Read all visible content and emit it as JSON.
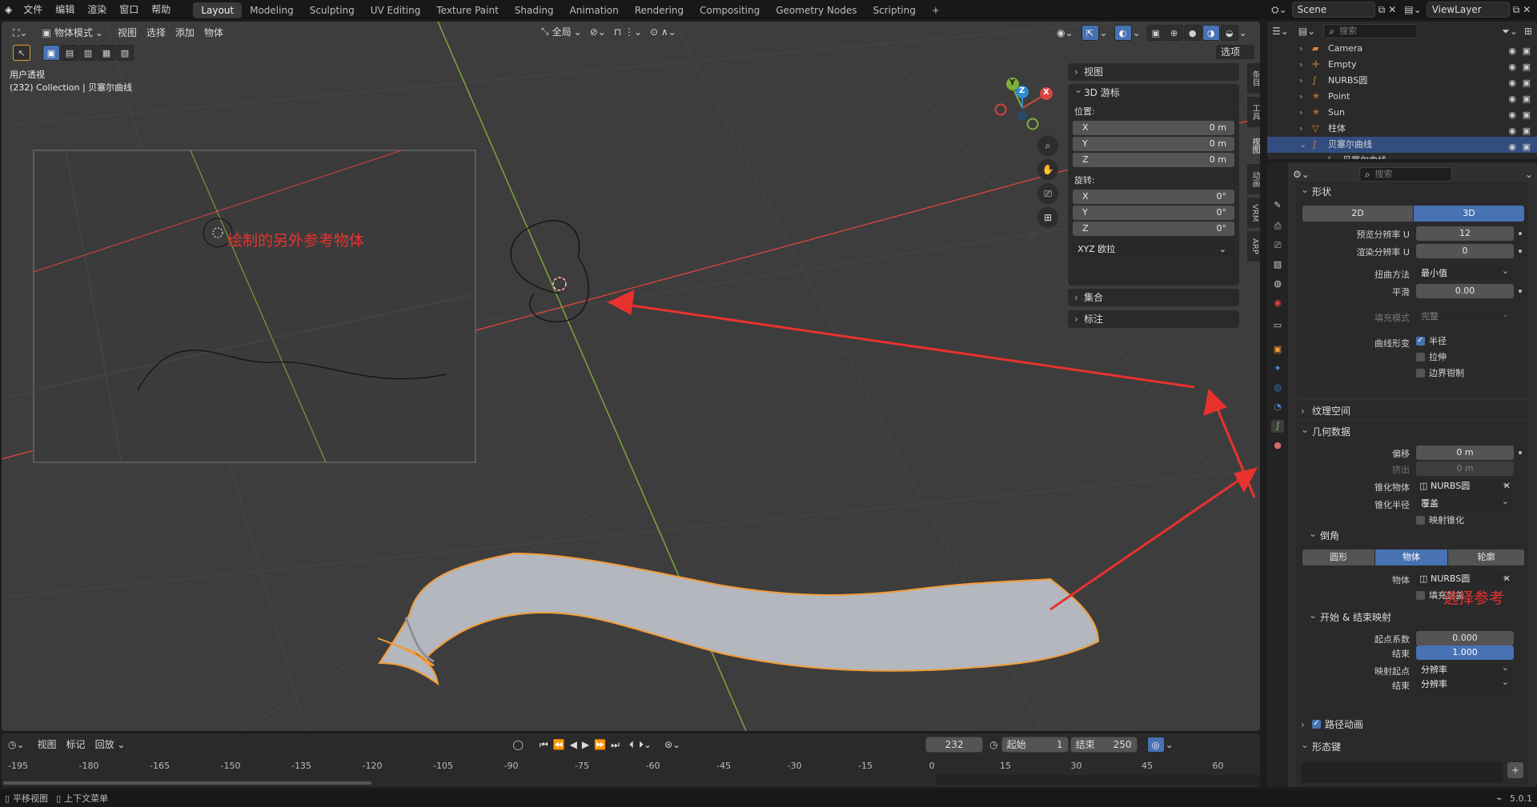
{
  "topbar": {
    "menus": [
      "文件",
      "编辑",
      "渲染",
      "窗口",
      "帮助"
    ],
    "workspaces": [
      "Layout",
      "Modeling",
      "Sculpting",
      "UV Editing",
      "Texture Paint",
      "Shading",
      "Animation",
      "Rendering",
      "Compositing",
      "Geometry Nodes",
      "Scripting"
    ],
    "active_workspace": "Layout",
    "add_tab": "+",
    "scene": "Scene",
    "view_layer": "ViewLayer"
  },
  "viewport": {
    "mode": "物体模式",
    "menus": [
      "视图",
      "选择",
      "添加",
      "物体"
    ],
    "transform_orientation": "全局",
    "options_label": "选项",
    "overlay_title": "用户透视",
    "overlay_subtitle": "(232) Collection | 贝塞尔曲线",
    "annotation_left": "绘制的另外参考物体",
    "annotation_right": "选择参考",
    "gizmo_x": "X",
    "gizmo_y": "Y",
    "gizmo_z": "Z",
    "colors": {
      "annotation": "#e8322e",
      "selection_outline": "#f29c38",
      "x_axis": "#d8453f",
      "y_axis": "#7fae3a",
      "z_axis": "#2e8bd1"
    }
  },
  "npanel": {
    "view_label": "视图",
    "cursor_label": "3D 游标",
    "location_label": "位置:",
    "location": [
      {
        "k": "X",
        "v": "0 m"
      },
      {
        "k": "Y",
        "v": "0 m"
      },
      {
        "k": "Z",
        "v": "0 m"
      }
    ],
    "rotation_label": "旋转:",
    "rotation": [
      {
        "k": "X",
        "v": "0°"
      },
      {
        "k": "Y",
        "v": "0°"
      },
      {
        "k": "Z",
        "v": "0°"
      }
    ],
    "rotation_mode": "XYZ 欧拉",
    "collection_label": "集合",
    "annotation_label": "标注",
    "tabs": [
      "条目",
      "工具",
      "视图",
      "动画",
      "VRM",
      "ARP"
    ],
    "active_tab": "视图"
  },
  "outliner": {
    "search_placeholder": "搜索",
    "items": [
      {
        "name": "Camera",
        "icon": "camera-icon"
      },
      {
        "name": "Empty",
        "icon": "empty-icon"
      },
      {
        "name": "NURBS圆",
        "icon": "curve-icon"
      },
      {
        "name": "Point",
        "icon": "light-icon"
      },
      {
        "name": "Sun",
        "icon": "light-icon"
      },
      {
        "name": "柱体",
        "icon": "mesh-icon"
      },
      {
        "name": "贝塞尔曲线",
        "icon": "curve-icon"
      },
      {
        "name": "贝塞尔曲线",
        "icon": "curve-data-icon"
      }
    ],
    "selected_index": 6
  },
  "properties": {
    "search_placeholder": "搜索",
    "shape": {
      "title": "形状",
      "dim_2d": "2D",
      "dim_3d": "3D",
      "preview_res_label": "预览分辨率 U",
      "preview_res": "12",
      "render_res_label": "渲染分辨率 U",
      "render_res": "0",
      "twist_label": "扭曲方法",
      "twist": "最小值",
      "smooth_label": "平滑",
      "smooth": "0.00",
      "fill_label": "填充模式",
      "fill": "完整",
      "deform_label": "曲线形变",
      "radius": "半径",
      "stretch": "拉伸",
      "clamp": "边界钳制"
    },
    "texspace_title": "纹理空间",
    "geometry": {
      "title": "几何数据",
      "offset_label": "偏移",
      "offset": "0 m",
      "extrude_label": "挤出",
      "extrude": "0 m",
      "taper_label": "锥化物体",
      "taper": "NURBS圆",
      "taper_radius_label": "锥化半径",
      "taper_radius": "覆盖",
      "map_taper": "映射锥化"
    },
    "bevel": {
      "title": "倒角",
      "round": "圆形",
      "object": "物体",
      "profile": "轮廓",
      "object_label": "物体",
      "object_value": "NURBS圆",
      "fill_caps": "填充封盖"
    },
    "startend": {
      "title": "开始 & 结束映射",
      "start_label": "起点系数",
      "start": "0.000",
      "end_label": "结束",
      "end": "1.000",
      "map_start_label": "映射起点",
      "map_start": "分辨率",
      "map_end_label": "结束",
      "map_end": "分辨率"
    },
    "path_anim_title": "路径动画",
    "shapekeys_title": "形态键",
    "shapekeys_add": "+"
  },
  "timeline": {
    "menus": [
      "视图",
      "标记"
    ],
    "playback": "回放",
    "current_frame": "232",
    "start_label": "起始",
    "start": "1",
    "end_label": "结束",
    "end": "250",
    "ticks": [
      "-195",
      "-180",
      "-165",
      "-150",
      "-135",
      "-120",
      "-105",
      "-90",
      "-75",
      "-60",
      "-45",
      "-30",
      "-15",
      "0",
      "15",
      "30",
      "45",
      "60"
    ]
  },
  "status": {
    "pan_hint": "平移视图",
    "context_hint": "上下文菜单",
    "version": "5.0.1"
  }
}
